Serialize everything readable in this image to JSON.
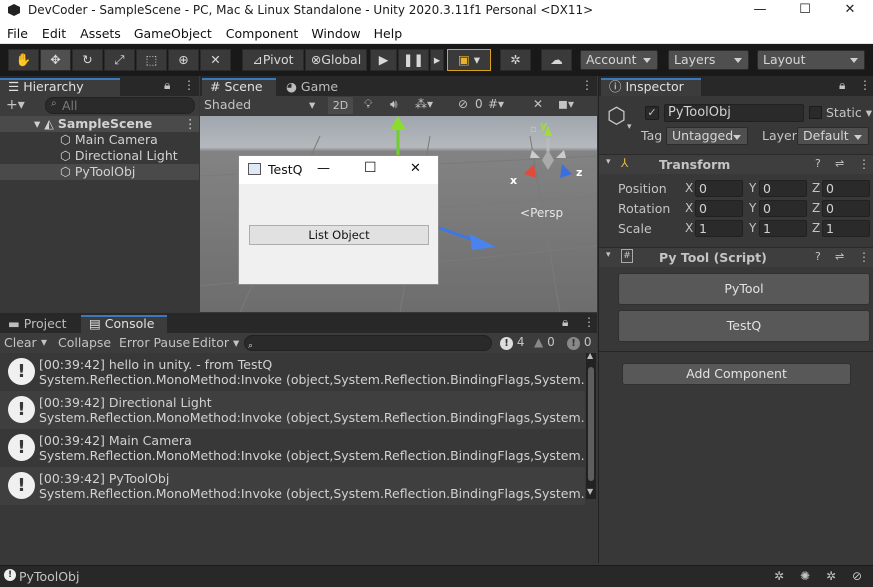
{
  "window": {
    "title": "DevCoder - SampleScene - PC, Mac & Linux Standalone - Unity 2020.3.11f1 Personal <DX11>",
    "minimize": "—",
    "maximize": "☐",
    "close": "✕"
  },
  "menu": [
    "File",
    "Edit",
    "Assets",
    "GameObject",
    "Component",
    "Window",
    "Help"
  ],
  "toolbar": {
    "pivot": "Pivot",
    "global": "Global",
    "account": "Account",
    "layers": "Layers",
    "layout": "Layout"
  },
  "hierarchy": {
    "tab": "Hierarchy",
    "search_placeholder": "All",
    "scene": "SampleScene",
    "items": [
      "Main Camera",
      "Directional Light",
      "PyToolObj"
    ]
  },
  "scene": {
    "tab_scene": "Scene",
    "tab_game": "Game",
    "shading": "Shaded",
    "mode_2d": "2D",
    "hidden_count": "0",
    "persp": "Persp",
    "axis_x": "x",
    "axis_y": "y",
    "axis_z": "z"
  },
  "dialog": {
    "title": "TestQ",
    "button": "List Object",
    "minimize": "—",
    "maximize": "☐",
    "close": "✕"
  },
  "console": {
    "tab_project": "Project",
    "tab_console": "Console",
    "clear": "Clear",
    "collapse": "Collapse",
    "error_pause": "Error Pause",
    "editor": "Editor",
    "count_log": "4",
    "count_warn": "0",
    "count_error": "0",
    "logs": [
      {
        "line1": "[00:39:42] hello in unity. - from TestQ",
        "line2": "System.Reflection.MonoMethod:Invoke (object,System.Reflection.BindingFlags,System.Reflectio"
      },
      {
        "line1": "[00:39:42] Directional Light",
        "line2": "System.Reflection.MonoMethod:Invoke (object,System.Reflection.BindingFlags,System.Reflectio"
      },
      {
        "line1": "[00:39:42] Main Camera",
        "line2": "System.Reflection.MonoMethod:Invoke (object,System.Reflection.BindingFlags,System.Reflectio"
      },
      {
        "line1": "[00:39:42] PyToolObj",
        "line2": "System.Reflection.MonoMethod:Invoke (object,System.Reflection.BindingFlags,System.Reflectio"
      }
    ]
  },
  "inspector": {
    "tab": "Inspector",
    "object_name": "PyToolObj",
    "static_label": "Static",
    "tag_label": "Tag",
    "tag_value": "Untagged",
    "layer_label": "Layer",
    "layer_value": "Default",
    "transform": {
      "title": "Transform",
      "position": "Position",
      "rotation": "Rotation",
      "scale": "Scale",
      "x": "X",
      "y": "Y",
      "z": "Z",
      "pos": [
        "0",
        "0",
        "0"
      ],
      "rot": [
        "0",
        "0",
        "0"
      ],
      "scl": [
        "1",
        "1",
        "1"
      ]
    },
    "script": {
      "title": "Py Tool (Script)",
      "btn1": "PyTool",
      "btn2": "TestQ"
    },
    "add_component": "Add Component"
  },
  "status": {
    "text": "PyToolObj"
  }
}
